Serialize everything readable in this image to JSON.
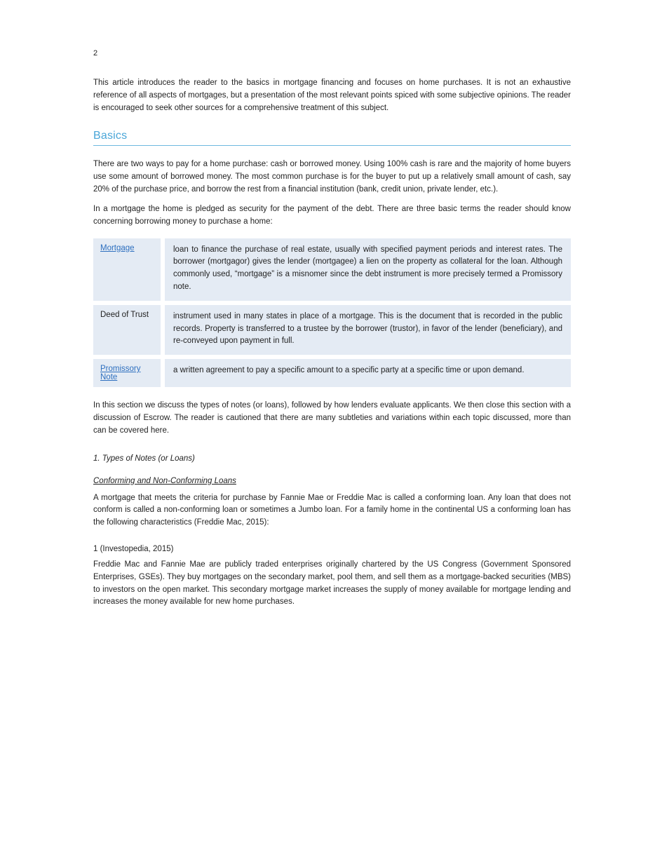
{
  "pageNumber": "2",
  "intro": "This article introduces the reader to the basics in mortgage financing and focuses on home purchases. It is not an exhaustive reference of all aspects of mortgages, but a presentation of the most relevant points spiced with some subjective opinions. The reader is encouraged to seek other sources for a comprehensive treatment of this subject.",
  "section": {
    "title": "Basics",
    "paragraphs": [
      "There are two ways to pay for a home purchase: cash or borrowed money. Using 100% cash is rare and the majority of home buyers use some amount of borrowed money. The most common purchase is for the buyer to put up a relatively small amount of cash, say 20% of the purchase price, and borrow the rest from a financial institution (bank, credit union, private lender, etc.).",
      "In a mortgage the home is pledged as security for the payment of the debt. There are three basic terms the reader should know concerning borrowing money to purchase a home:"
    ],
    "definitions": [
      {
        "term": "Mortgage",
        "termIsLink": true,
        "description": "loan to finance the purchase of real estate, usually with specified payment periods and interest rates. The borrower (mortgagor) gives the lender (mortgagee) a lien on the property as collateral for the loan. Although commonly used, “mortgage” is a misnomer since the debt instrument is more precisely termed a Promissory note."
      },
      {
        "term": "Deed of Trust",
        "termIsLink": false,
        "description": "instrument used in many states in place of a mortgage. This is the document that is recorded in the public records. Property is transferred to a trustee by the borrower (trustor), in favor of the lender (beneficiary), and re-conveyed upon payment in full."
      },
      {
        "term": "Promissory Note",
        "termIsLink": true,
        "description": "a written agreement to pay a specific amount to a specific party at a specific time or upon demand."
      }
    ],
    "sectionHeadings": {
      "heading": "1. Types of Notes (or Loans)",
      "paragraph": "In this section we discuss the types of notes (or loans), followed by how lenders evaluate applicants. We then close this section with a discussion of Escrow. The reader is cautioned that there are many subtleties and variations within each topic discussed, more than can be covered here.",
      "sub1": {
        "title": "Conforming and Non-Conforming Loans",
        "paragraph": "A mortgage that meets the criteria for purchase by Fannie Mae or Freddie Mac is called a conforming loan. Any loan that does not conform is called a non-conforming loan or sometimes a Jumbo loan. For a family home in the continental US a conforming loan has the following characteristics (Freddie Mac, 2015):"
      },
      "citationTitle": "1 (Investopedia, 2015)",
      "citationBody": "Freddie Mac and Fannie Mae are publicly traded enterprises originally chartered by the US Congress (Government Sponsored Enterprises, GSEs). They buy mortgages on the secondary market, pool them, and sell them as a mortgage-backed securities (MBS) to investors on the open market. This secondary mortgage market increases the supply of money available for mortgage lending and increases the money available for new home purchases."
    }
  }
}
